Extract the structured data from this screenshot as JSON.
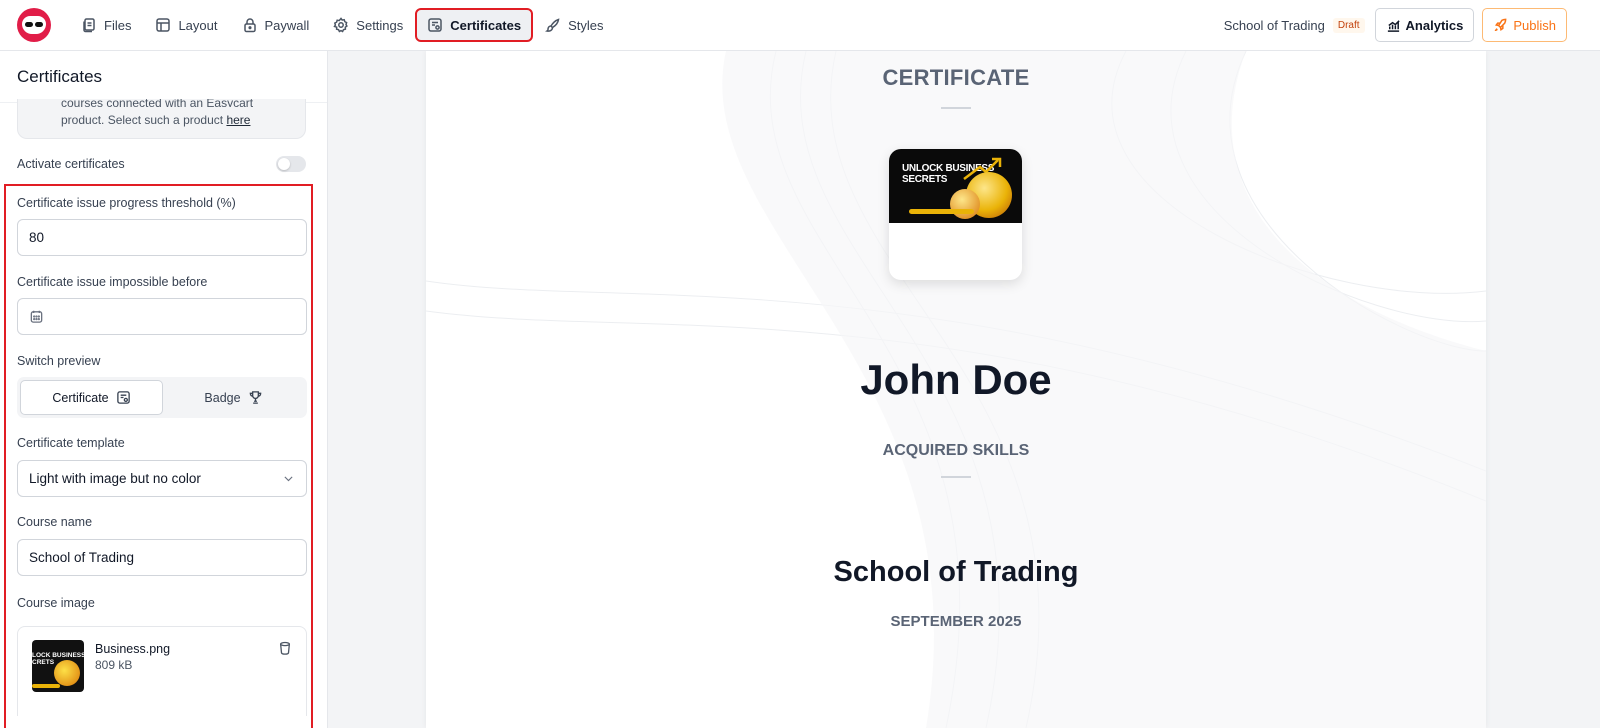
{
  "nav": {
    "items": [
      {
        "label": "Files",
        "icon": "files-icon"
      },
      {
        "label": "Layout",
        "icon": "layout-icon"
      },
      {
        "label": "Paywall",
        "icon": "lock-icon"
      },
      {
        "label": "Settings",
        "icon": "gear-icon"
      },
      {
        "label": "Certificates",
        "icon": "certificate-icon",
        "active": true
      },
      {
        "label": "Styles",
        "icon": "brush-icon"
      }
    ],
    "project_name": "School of Trading",
    "status": "Draft",
    "analytics_label": "Analytics",
    "publish_label": "Publish"
  },
  "sidebar": {
    "title": "Certificates",
    "notice_line1": "courses connected with an Easycart",
    "notice_line2": "product. Select such a product ",
    "notice_link": "here",
    "activate_label": "Activate certificates",
    "activate_on": false,
    "threshold_label": "Certificate issue progress threshold (%)",
    "threshold_value": "80",
    "impossible_before_label": "Certificate issue impossible before",
    "impossible_before_value": "",
    "switch_label": "Switch preview",
    "switch_options": [
      "Certificate",
      "Badge"
    ],
    "switch_selected": "Certificate",
    "template_label": "Certificate template",
    "template_value": "Light with image but no color",
    "course_name_label": "Course name",
    "course_name_value": "School of Trading",
    "course_image_label": "Course image",
    "file": {
      "name": "Business.png",
      "size": "809 kB",
      "thumb_text": "LOCK BUSINESS\nCRETS"
    }
  },
  "certificate": {
    "heading": "CERTIFICATE",
    "image_text": "UNLOCK BUSINESS\nSECRETS",
    "student": "John Doe",
    "skills_heading": "ACQUIRED SKILLS",
    "course": "School of Trading",
    "date": "SEPTEMBER 2025"
  },
  "colors": {
    "accent_highlight": "#e11d24",
    "publish": "#f97316",
    "logo": "#e11d48"
  }
}
